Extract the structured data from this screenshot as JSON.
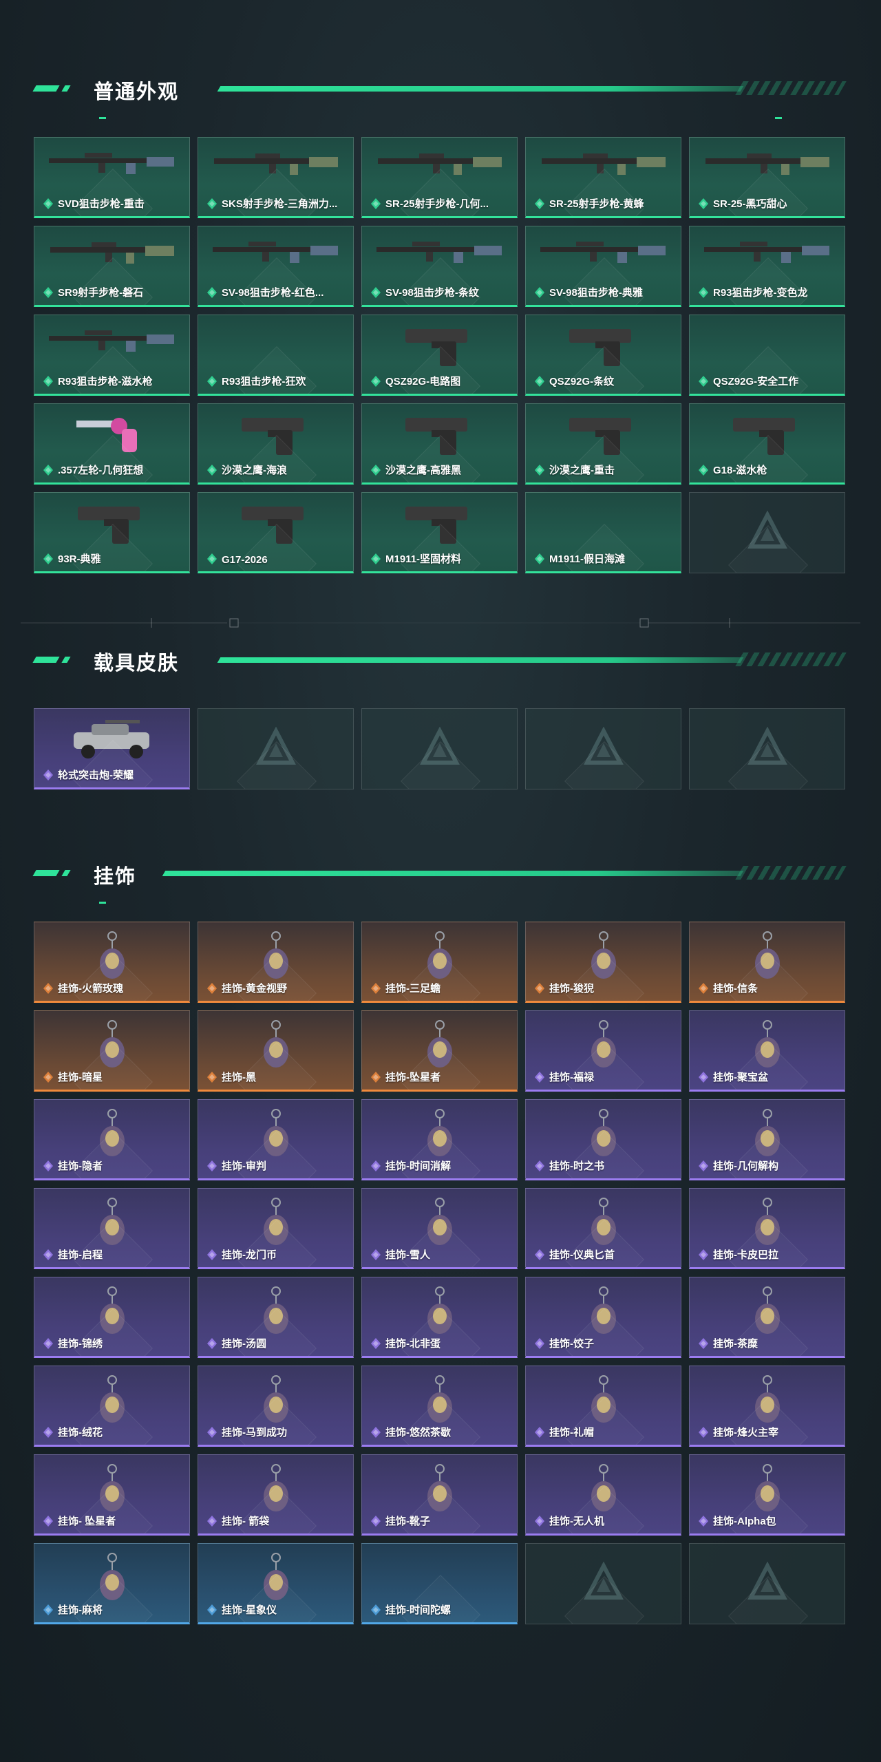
{
  "sections": {
    "weapons": {
      "title": "普通外观",
      "items": [
        {
          "label": "SVD狙击步枪-重击",
          "rarity": "green",
          "icon": "sniper-rifle-icon"
        },
        {
          "label": "SKS射手步枪-三角洲力...",
          "rarity": "green",
          "icon": "rifle-icon"
        },
        {
          "label": "SR-25射手步枪-几何...",
          "rarity": "green",
          "icon": "rifle-icon"
        },
        {
          "label": "SR-25射手步枪-黄蜂",
          "rarity": "green",
          "icon": "rifle-icon"
        },
        {
          "label": "SR-25-黑巧甜心",
          "rarity": "green",
          "icon": "rifle-icon"
        },
        {
          "label": "SR9射手步枪-磐石",
          "rarity": "green",
          "icon": "rifle-icon"
        },
        {
          "label": "SV-98狙击步枪-红色...",
          "rarity": "green",
          "icon": "sniper-rifle-icon"
        },
        {
          "label": "SV-98狙击步枪-条纹",
          "rarity": "green",
          "icon": "sniper-rifle-icon"
        },
        {
          "label": "SV-98狙击步枪-典雅",
          "rarity": "green",
          "icon": "sniper-rifle-icon"
        },
        {
          "label": "R93狙击步枪-变色龙",
          "rarity": "green",
          "icon": "sniper-rifle-icon"
        },
        {
          "label": "R93狙击步枪-滋水枪",
          "rarity": "green",
          "icon": "sniper-rifle-icon"
        },
        {
          "label": "R93狙击步枪-狂欢",
          "rarity": "green",
          "icon": ""
        },
        {
          "label": "QSZ92G-电路图",
          "rarity": "green",
          "icon": "pistol-icon"
        },
        {
          "label": "QSZ92G-条纹",
          "rarity": "green",
          "icon": "pistol-icon"
        },
        {
          "label": "QSZ92G-安全工作",
          "rarity": "green",
          "icon": ""
        },
        {
          "label": ".357左轮-几何狂想",
          "rarity": "green",
          "icon": "revolver-icon"
        },
        {
          "label": "沙漠之鹰-海浪",
          "rarity": "green",
          "icon": "pistol-icon"
        },
        {
          "label": "沙漠之鹰-高雅黑",
          "rarity": "green",
          "icon": "pistol-icon"
        },
        {
          "label": "沙漠之鹰-重击",
          "rarity": "green",
          "icon": "pistol-icon"
        },
        {
          "label": "G18-滋水枪",
          "rarity": "green",
          "icon": "pistol-icon"
        },
        {
          "label": "93R-典雅",
          "rarity": "green",
          "icon": "pistol-icon"
        },
        {
          "label": "G17-2026",
          "rarity": "green",
          "icon": "pistol-icon"
        },
        {
          "label": "M1911-坚固材料",
          "rarity": "green",
          "icon": "pistol-icon"
        },
        {
          "label": "M1911-假日海滩",
          "rarity": "green",
          "icon": ""
        },
        {
          "label": "",
          "rarity": "empty",
          "icon": "placeholder-logo-icon"
        }
      ]
    },
    "vehicles": {
      "title": "载具皮肤",
      "items": [
        {
          "label": "轮式突击炮-荣耀",
          "rarity": "purple",
          "icon": "vehicle-icon"
        },
        {
          "label": "",
          "rarity": "empty",
          "icon": "placeholder-logo-icon"
        },
        {
          "label": "",
          "rarity": "empty",
          "icon": "placeholder-logo-icon"
        },
        {
          "label": "",
          "rarity": "empty",
          "icon": "placeholder-logo-icon"
        },
        {
          "label": "",
          "rarity": "empty",
          "icon": "placeholder-logo-icon"
        }
      ]
    },
    "charms": {
      "title": "挂饰",
      "items": [
        {
          "label": "挂饰-火箭玫瑰",
          "rarity": "orange",
          "icon": "charm-icon"
        },
        {
          "label": "挂饰-黄金视野",
          "rarity": "orange",
          "icon": "charm-icon"
        },
        {
          "label": "挂饰-三足蟾",
          "rarity": "orange",
          "icon": "charm-icon"
        },
        {
          "label": "挂饰-狻猊",
          "rarity": "orange",
          "icon": "charm-icon"
        },
        {
          "label": "挂饰-信条",
          "rarity": "orange",
          "icon": "charm-icon"
        },
        {
          "label": "挂饰-暗星",
          "rarity": "orange",
          "icon": "charm-icon"
        },
        {
          "label": "挂饰-黑",
          "rarity": "orange",
          "icon": "charm-icon"
        },
        {
          "label": "挂饰-坠星者",
          "rarity": "orange",
          "icon": "charm-icon"
        },
        {
          "label": "挂饰-福禄",
          "rarity": "purple",
          "icon": "charm-icon"
        },
        {
          "label": "挂饰-聚宝盆",
          "rarity": "purple",
          "icon": "charm-icon"
        },
        {
          "label": "挂饰-隐者",
          "rarity": "purple",
          "icon": "charm-icon"
        },
        {
          "label": "挂饰-审判",
          "rarity": "purple",
          "icon": "charm-icon"
        },
        {
          "label": "挂饰-时间消解",
          "rarity": "purple",
          "icon": "charm-icon"
        },
        {
          "label": "挂饰-时之书",
          "rarity": "purple",
          "icon": "charm-icon"
        },
        {
          "label": "挂饰-几何解构",
          "rarity": "purple",
          "icon": "charm-icon"
        },
        {
          "label": "挂饰-启程",
          "rarity": "purple",
          "icon": "charm-icon"
        },
        {
          "label": "挂饰-龙门币",
          "rarity": "purple",
          "icon": "charm-icon"
        },
        {
          "label": "挂饰-雪人",
          "rarity": "purple",
          "icon": "charm-icon"
        },
        {
          "label": "挂饰-仪典匕首",
          "rarity": "purple",
          "icon": "charm-icon"
        },
        {
          "label": "挂饰-卡皮巴拉",
          "rarity": "purple",
          "icon": "charm-icon"
        },
        {
          "label": "挂饰-锦绣",
          "rarity": "purple",
          "icon": "charm-icon"
        },
        {
          "label": "挂饰-汤圆",
          "rarity": "purple",
          "icon": "charm-icon"
        },
        {
          "label": "挂饰-北非蛋",
          "rarity": "purple",
          "icon": "charm-icon"
        },
        {
          "label": "挂饰-饺子",
          "rarity": "purple",
          "icon": "charm-icon"
        },
        {
          "label": "挂饰-茶糜",
          "rarity": "purple",
          "icon": "charm-icon"
        },
        {
          "label": "挂饰-绒花",
          "rarity": "purple",
          "icon": "charm-icon"
        },
        {
          "label": "挂饰-马到成功",
          "rarity": "purple",
          "icon": "charm-icon"
        },
        {
          "label": "挂饰-悠然茶歇",
          "rarity": "purple",
          "icon": "charm-icon"
        },
        {
          "label": "挂饰-礼帽",
          "rarity": "purple",
          "icon": "charm-icon"
        },
        {
          "label": "挂饰-烽火主宰",
          "rarity": "purple",
          "icon": "charm-icon"
        },
        {
          "label": "挂饰- 坠星者",
          "rarity": "purple",
          "icon": "charm-icon"
        },
        {
          "label": "挂饰- 箭袋",
          "rarity": "purple",
          "icon": "charm-icon"
        },
        {
          "label": "挂饰-靴子",
          "rarity": "purple",
          "icon": "charm-icon"
        },
        {
          "label": "挂饰-无人机",
          "rarity": "purple",
          "icon": "charm-icon"
        },
        {
          "label": "挂饰-Alpha包",
          "rarity": "purple",
          "icon": "charm-icon"
        },
        {
          "label": "挂饰-麻将",
          "rarity": "blue",
          "icon": "charm-icon"
        },
        {
          "label": "挂饰-星象仪",
          "rarity": "blue",
          "icon": "charm-icon"
        },
        {
          "label": "挂饰-时间陀螺",
          "rarity": "blue",
          "icon": ""
        },
        {
          "label": "",
          "rarity": "empty",
          "icon": "placeholder-logo-icon"
        },
        {
          "label": "",
          "rarity": "empty",
          "icon": "placeholder-logo-icon"
        }
      ]
    }
  },
  "colors": {
    "accent": "#2fe39a",
    "green": "#33e39b",
    "purple": "#9b7cf0",
    "orange": "#f08a3c",
    "blue": "#52a8e8"
  }
}
